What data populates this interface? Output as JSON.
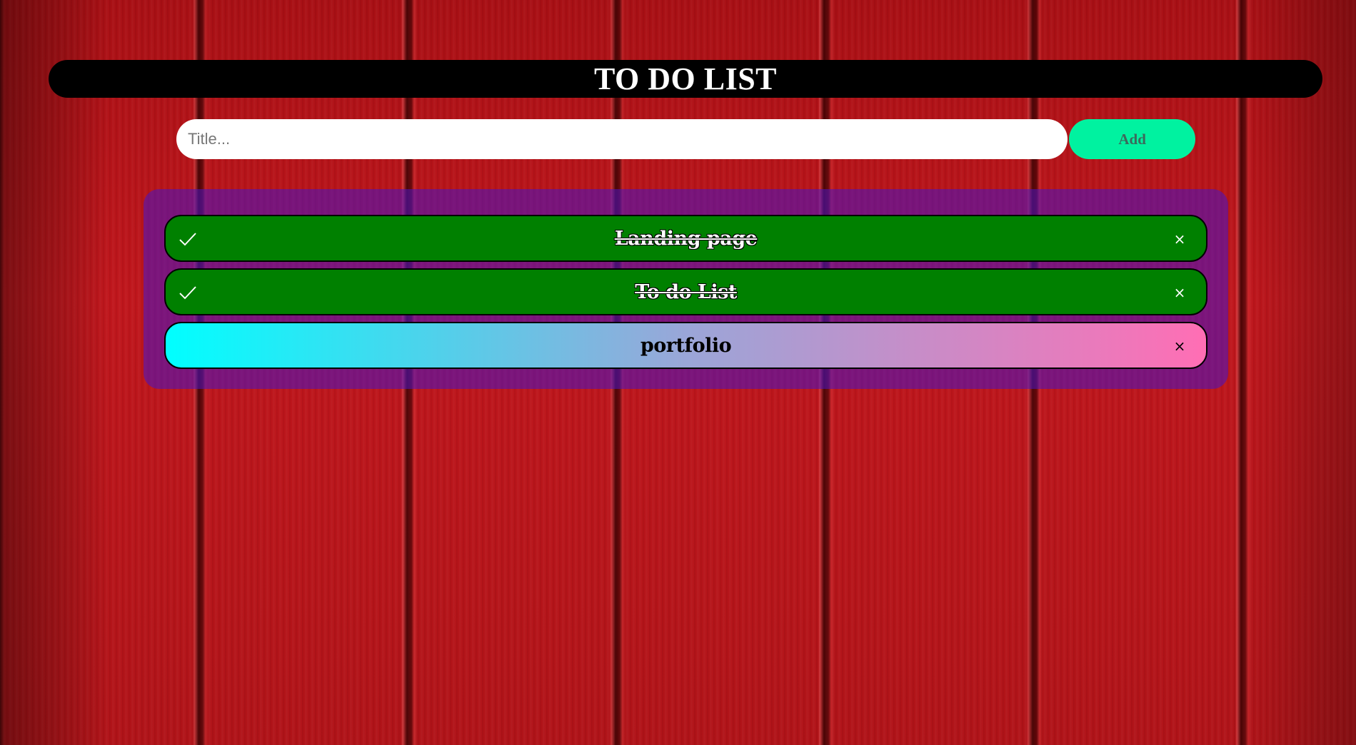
{
  "header": {
    "title": "TO DO LIST"
  },
  "form": {
    "placeholder": "Title...",
    "value": "",
    "add_label": "Add"
  },
  "todos": [
    {
      "label": "Landing page",
      "done": true,
      "close": "×",
      "check_icon": "check-icon"
    },
    {
      "label": "To do List",
      "done": true,
      "close": "×",
      "check_icon": "check-icon"
    },
    {
      "label": "portfolio",
      "done": false,
      "close": "×"
    }
  ],
  "colors": {
    "header_bg": "#000000",
    "add_button": "#00f2a0",
    "done_item": "#008000",
    "pending_gradient_start": "#00ffff",
    "pending_gradient_end": "#ff6eb4",
    "panel": "#4614c8"
  }
}
